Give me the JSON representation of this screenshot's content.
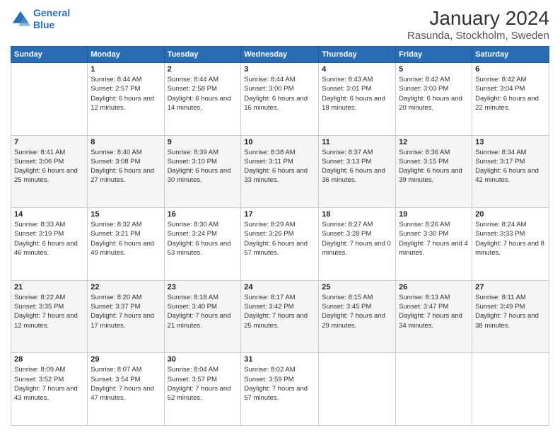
{
  "logo": {
    "line1": "General",
    "line2": "Blue"
  },
  "title": "January 2024",
  "subtitle": "Rasunda, Stockholm, Sweden",
  "days_of_week": [
    "Sunday",
    "Monday",
    "Tuesday",
    "Wednesday",
    "Thursday",
    "Friday",
    "Saturday"
  ],
  "weeks": [
    [
      {
        "day": "",
        "sunrise": "",
        "sunset": "",
        "daylight": ""
      },
      {
        "day": "1",
        "sunrise": "Sunrise: 8:44 AM",
        "sunset": "Sunset: 2:57 PM",
        "daylight": "Daylight: 6 hours and 12 minutes."
      },
      {
        "day": "2",
        "sunrise": "Sunrise: 8:44 AM",
        "sunset": "Sunset: 2:58 PM",
        "daylight": "Daylight: 6 hours and 14 minutes."
      },
      {
        "day": "3",
        "sunrise": "Sunrise: 8:44 AM",
        "sunset": "Sunset: 3:00 PM",
        "daylight": "Daylight: 6 hours and 16 minutes."
      },
      {
        "day": "4",
        "sunrise": "Sunrise: 8:43 AM",
        "sunset": "Sunset: 3:01 PM",
        "daylight": "Daylight: 6 hours and 18 minutes."
      },
      {
        "day": "5",
        "sunrise": "Sunrise: 8:42 AM",
        "sunset": "Sunset: 3:03 PM",
        "daylight": "Daylight: 6 hours and 20 minutes."
      },
      {
        "day": "6",
        "sunrise": "Sunrise: 8:42 AM",
        "sunset": "Sunset: 3:04 PM",
        "daylight": "Daylight: 6 hours and 22 minutes."
      }
    ],
    [
      {
        "day": "7",
        "sunrise": "Sunrise: 8:41 AM",
        "sunset": "Sunset: 3:06 PM",
        "daylight": "Daylight: 6 hours and 25 minutes."
      },
      {
        "day": "8",
        "sunrise": "Sunrise: 8:40 AM",
        "sunset": "Sunset: 3:08 PM",
        "daylight": "Daylight: 6 hours and 27 minutes."
      },
      {
        "day": "9",
        "sunrise": "Sunrise: 8:39 AM",
        "sunset": "Sunset: 3:10 PM",
        "daylight": "Daylight: 6 hours and 30 minutes."
      },
      {
        "day": "10",
        "sunrise": "Sunrise: 8:38 AM",
        "sunset": "Sunset: 3:11 PM",
        "daylight": "Daylight: 6 hours and 33 minutes."
      },
      {
        "day": "11",
        "sunrise": "Sunrise: 8:37 AM",
        "sunset": "Sunset: 3:13 PM",
        "daylight": "Daylight: 6 hours and 36 minutes."
      },
      {
        "day": "12",
        "sunrise": "Sunrise: 8:36 AM",
        "sunset": "Sunset: 3:15 PM",
        "daylight": "Daylight: 6 hours and 39 minutes."
      },
      {
        "day": "13",
        "sunrise": "Sunrise: 8:34 AM",
        "sunset": "Sunset: 3:17 PM",
        "daylight": "Daylight: 6 hours and 42 minutes."
      }
    ],
    [
      {
        "day": "14",
        "sunrise": "Sunrise: 8:33 AM",
        "sunset": "Sunset: 3:19 PM",
        "daylight": "Daylight: 6 hours and 46 minutes."
      },
      {
        "day": "15",
        "sunrise": "Sunrise: 8:32 AM",
        "sunset": "Sunset: 3:21 PM",
        "daylight": "Daylight: 6 hours and 49 minutes."
      },
      {
        "day": "16",
        "sunrise": "Sunrise: 8:30 AM",
        "sunset": "Sunset: 3:24 PM",
        "daylight": "Daylight: 6 hours and 53 minutes."
      },
      {
        "day": "17",
        "sunrise": "Sunrise: 8:29 AM",
        "sunset": "Sunset: 3:26 PM",
        "daylight": "Daylight: 6 hours and 57 minutes."
      },
      {
        "day": "18",
        "sunrise": "Sunrise: 8:27 AM",
        "sunset": "Sunset: 3:28 PM",
        "daylight": "Daylight: 7 hours and 0 minutes."
      },
      {
        "day": "19",
        "sunrise": "Sunrise: 8:26 AM",
        "sunset": "Sunset: 3:30 PM",
        "daylight": "Daylight: 7 hours and 4 minutes."
      },
      {
        "day": "20",
        "sunrise": "Sunrise: 8:24 AM",
        "sunset": "Sunset: 3:33 PM",
        "daylight": "Daylight: 7 hours and 8 minutes."
      }
    ],
    [
      {
        "day": "21",
        "sunrise": "Sunrise: 8:22 AM",
        "sunset": "Sunset: 3:35 PM",
        "daylight": "Daylight: 7 hours and 12 minutes."
      },
      {
        "day": "22",
        "sunrise": "Sunrise: 8:20 AM",
        "sunset": "Sunset: 3:37 PM",
        "daylight": "Daylight: 7 hours and 17 minutes."
      },
      {
        "day": "23",
        "sunrise": "Sunrise: 8:18 AM",
        "sunset": "Sunset: 3:40 PM",
        "daylight": "Daylight: 7 hours and 21 minutes."
      },
      {
        "day": "24",
        "sunrise": "Sunrise: 8:17 AM",
        "sunset": "Sunset: 3:42 PM",
        "daylight": "Daylight: 7 hours and 25 minutes."
      },
      {
        "day": "25",
        "sunrise": "Sunrise: 8:15 AM",
        "sunset": "Sunset: 3:45 PM",
        "daylight": "Daylight: 7 hours and 29 minutes."
      },
      {
        "day": "26",
        "sunrise": "Sunrise: 8:13 AM",
        "sunset": "Sunset: 3:47 PM",
        "daylight": "Daylight: 7 hours and 34 minutes."
      },
      {
        "day": "27",
        "sunrise": "Sunrise: 8:11 AM",
        "sunset": "Sunset: 3:49 PM",
        "daylight": "Daylight: 7 hours and 38 minutes."
      }
    ],
    [
      {
        "day": "28",
        "sunrise": "Sunrise: 8:09 AM",
        "sunset": "Sunset: 3:52 PM",
        "daylight": "Daylight: 7 hours and 43 minutes."
      },
      {
        "day": "29",
        "sunrise": "Sunrise: 8:07 AM",
        "sunset": "Sunset: 3:54 PM",
        "daylight": "Daylight: 7 hours and 47 minutes."
      },
      {
        "day": "30",
        "sunrise": "Sunrise: 8:04 AM",
        "sunset": "Sunset: 3:57 PM",
        "daylight": "Daylight: 7 hours and 52 minutes."
      },
      {
        "day": "31",
        "sunrise": "Sunrise: 8:02 AM",
        "sunset": "Sunset: 3:59 PM",
        "daylight": "Daylight: 7 hours and 57 minutes."
      },
      {
        "day": "",
        "sunrise": "",
        "sunset": "",
        "daylight": ""
      },
      {
        "day": "",
        "sunrise": "",
        "sunset": "",
        "daylight": ""
      },
      {
        "day": "",
        "sunrise": "",
        "sunset": "",
        "daylight": ""
      }
    ]
  ]
}
